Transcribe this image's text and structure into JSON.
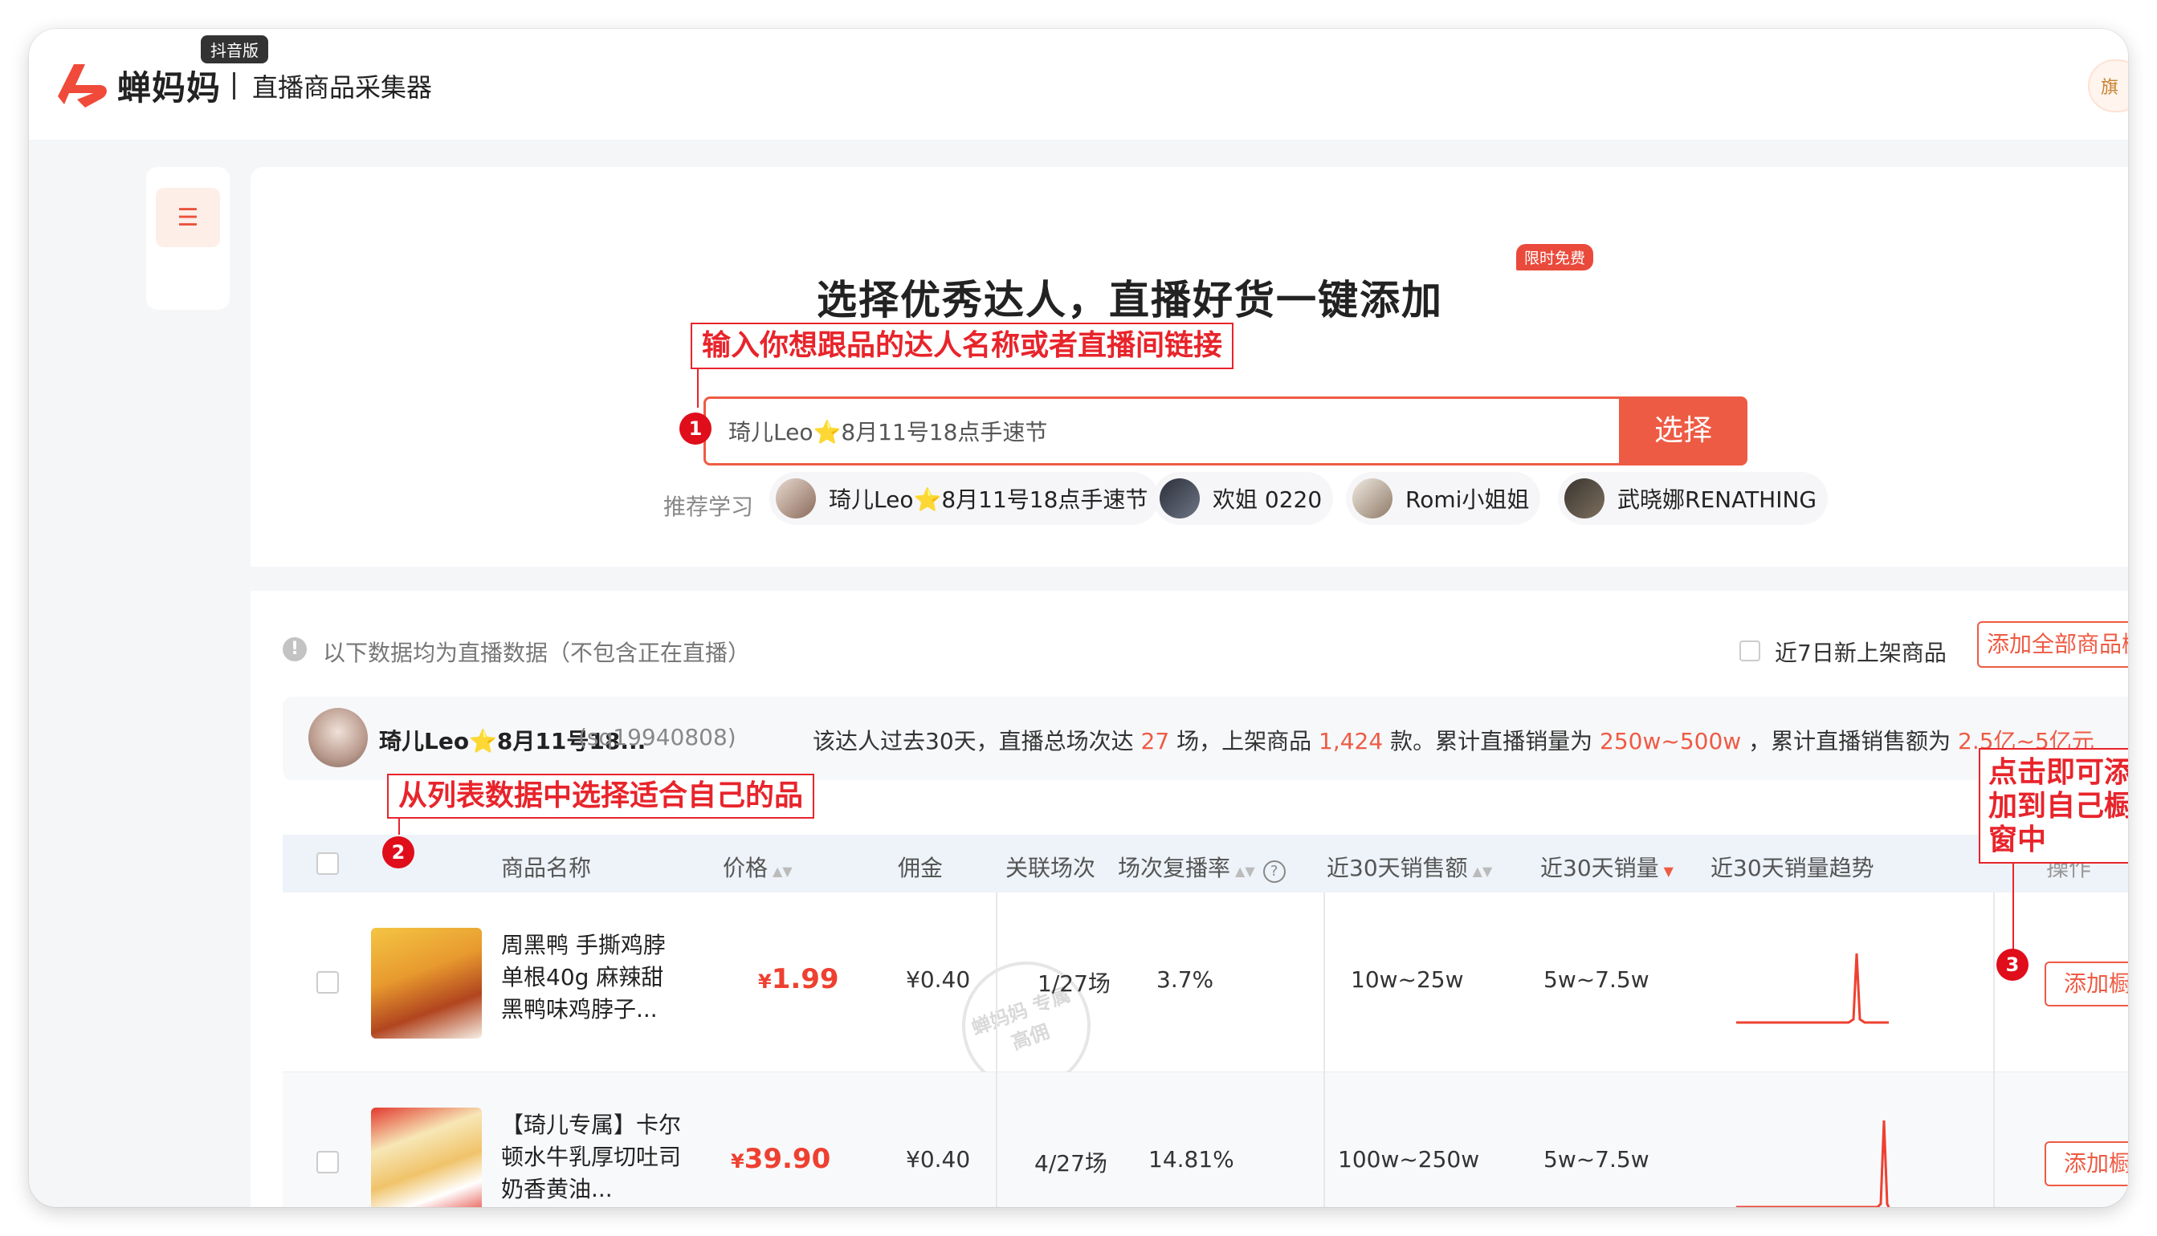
{
  "app": {
    "brand": "蝉妈妈",
    "badge": "抖音版",
    "subtitle": "直播商品采集器",
    "user_chip": "旗"
  },
  "hero": {
    "title": "选择优秀达人，直播好货一键添加",
    "free_tag": "限时免费"
  },
  "search": {
    "value": "琦儿Leo⭐8月11号18点手速节",
    "button": "选择"
  },
  "recommend": {
    "label": "推荐学习",
    "items": [
      {
        "name": "琦儿Leo⭐8月11号18点手速节"
      },
      {
        "name": "欢姐 0220"
      },
      {
        "name": "Romi小姐姐"
      },
      {
        "name": "武晓娜RENATHING"
      }
    ]
  },
  "notice": {
    "icon": "!",
    "text": "以下数据均为直播数据（不包含正在直播）",
    "new_filter": "近7日新上架商品",
    "add_all": "添加全部商品橱窗"
  },
  "influencer": {
    "name": "琦儿Leo⭐8月11号18...",
    "id": "(sq19940808)",
    "desc_1": "该达人过去30天，直播总场次达",
    "sessions": "27",
    "desc_2": "场，上架商品",
    "products": "1,424",
    "desc_3": "款。累计直播销量为",
    "sales_volume": "250w~500w",
    "desc_4": "，累计直播销售额为",
    "sales_amount": "2.5亿~5亿元"
  },
  "annotations": {
    "a1": "输入你想跟品的达人名称或者直播间链接",
    "a2": "从列表数据中选择适合自己的品",
    "a3": "点击即可添加到自己橱窗中",
    "n1": "1",
    "n2": "2",
    "n3": "3"
  },
  "table": {
    "headers": {
      "name": "商品名称",
      "price": "价格",
      "commission": "佣金",
      "sessions": "关联场次",
      "replay_rate": "场次复播率",
      "sales_amount": "近30天销售额",
      "sales_volume": "近30天销量",
      "trend": "近30天销量趋势",
      "action": "操作"
    },
    "rows": [
      {
        "name": "周黑鸭 手撕鸡脖单根40g 麻辣甜黑鸭味鸡脖子...",
        "price_symbol": "¥",
        "price": "1.99",
        "commission": "¥0.40",
        "sessions": "1/27场",
        "replay_rate": "3.7%",
        "sales_amount": "10w~25w",
        "sales_volume": "5w~7.5w",
        "action": "添加橱窗",
        "stamp": "蝉妈妈 专属高佣"
      },
      {
        "name": "【琦儿专属】卡尔顿水牛乳厚切吐司奶香黄油...",
        "price_symbol": "¥",
        "price": "39.90",
        "commission": "¥0.40",
        "sessions": "4/27场",
        "replay_rate": "14.81%",
        "sales_amount": "100w~250w",
        "sales_volume": "5w~7.5w",
        "action": "添加橱窗"
      }
    ]
  },
  "colors": {
    "accent": "#ee5b44",
    "annotation": "#e8242b",
    "price": "#ee4030"
  },
  "icons": [
    "logo-icon",
    "list-menu-icon",
    "alert-icon",
    "help-icon",
    "sort-icon"
  ]
}
